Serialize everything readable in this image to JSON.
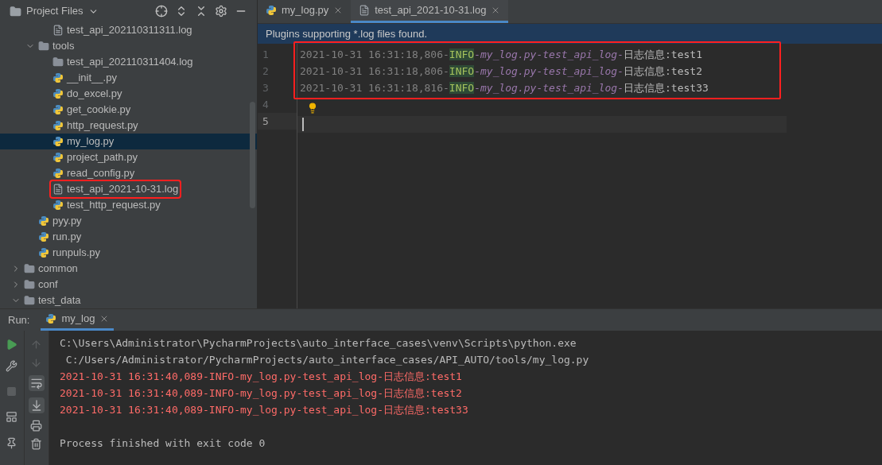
{
  "project": {
    "title": "Project Files",
    "tree": [
      {
        "children": [
          {
            "children": [
              {
                "label": "test_api_202110311311.log",
                "kind": "log",
                "selected": false,
                "outlined": false
              }
            ]
          },
          {
            "label": "tools",
            "kind": "folder",
            "expanded": true,
            "selected": false,
            "outlined": false,
            "children": [
              {
                "label": "test_api_202110311404.log",
                "kind": "plainfolder",
                "selected": false,
                "outlined": false
              },
              {
                "label": "__init__.py",
                "kind": "py",
                "selected": false,
                "outlined": false
              },
              {
                "label": "do_excel.py",
                "kind": "py",
                "selected": false,
                "outlined": false
              },
              {
                "label": "get_cookie.py",
                "kind": "py",
                "selected": false,
                "outlined": false
              },
              {
                "label": "http_request.py",
                "kind": "py",
                "selected": false,
                "outlined": false
              },
              {
                "label": "my_log.py",
                "kind": "py",
                "selected": true,
                "outlined": false
              },
              {
                "label": "project_path.py",
                "kind": "py",
                "selected": false,
                "outlined": false
              },
              {
                "label": "read_config.py",
                "kind": "py",
                "selected": false,
                "outlined": false
              },
              {
                "label": "test_api_2021-10-31.log",
                "kind": "log",
                "selected": false,
                "outlined": true
              },
              {
                "label": "test_http_request.py",
                "kind": "py",
                "selected": false,
                "outlined": false
              }
            ]
          },
          {
            "label": "pyy.py",
            "kind": "py",
            "selected": false,
            "outlined": false
          },
          {
            "label": "run.py",
            "kind": "py",
            "selected": false,
            "outlined": false
          },
          {
            "label": "runpuls.py",
            "kind": "py",
            "selected": false,
            "outlined": false
          }
        ]
      },
      {
        "label": "common",
        "kind": "folder",
        "expanded": false,
        "selected": false,
        "outlined": false
      },
      {
        "label": "conf",
        "kind": "folder",
        "expanded": false,
        "selected": false,
        "outlined": false
      },
      {
        "label": "test_data",
        "kind": "folder",
        "expanded": true,
        "selected": false,
        "outlined": false
      }
    ]
  },
  "editor": {
    "tabs": [
      {
        "label": "my_log.py",
        "kind": "py",
        "selected": false
      },
      {
        "label": "test_api_2021-10-31.log",
        "kind": "log",
        "selected": true
      }
    ],
    "banner": "Plugins supporting *.log files found.",
    "lines": [
      {
        "number": "1",
        "in_box": true,
        "current": false,
        "bulb": false,
        "segments": [
          {
            "text": "2021-10-31 16:31:18,806-",
            "kind": "time"
          },
          {
            "text": "INFO",
            "kind": "level"
          },
          {
            "text": "-my_log.py-test_api_log-",
            "kind": "name"
          },
          {
            "text": "日志信息:test1",
            "kind": "msg"
          }
        ]
      },
      {
        "number": "2",
        "in_box": true,
        "current": false,
        "bulb": false,
        "segments": [
          {
            "text": "2021-10-31 16:31:18,806-",
            "kind": "time"
          },
          {
            "text": "INFO",
            "kind": "level"
          },
          {
            "text": "-my_log.py-test_api_log-",
            "kind": "name"
          },
          {
            "text": "日志信息:test2",
            "kind": "msg"
          }
        ]
      },
      {
        "number": "3",
        "in_box": true,
        "current": false,
        "bulb": false,
        "segments": [
          {
            "text": "2021-10-31 16:31:18,816-",
            "kind": "time"
          },
          {
            "text": "INFO",
            "kind": "level"
          },
          {
            "text": "-my_log.py-test_api_log-",
            "kind": "name"
          },
          {
            "text": "日志信息:test33",
            "kind": "msg"
          }
        ]
      },
      {
        "number": "4",
        "in_box": false,
        "current": false,
        "bulb": true
      },
      {
        "number": "5",
        "in_box": false,
        "current": true,
        "bulb": false
      }
    ]
  },
  "run": {
    "label": "Run:",
    "tab": "my_log",
    "output": [
      {
        "text": "C:\\Users\\Administrator\\PycharmProjects\\auto_interface_cases\\venv\\Scripts\\python.exe",
        "kind": "plain"
      },
      {
        "text": " C:/Users/Administrator/PycharmProjects/auto_interface_cases/API_AUTO/tools/my_log.py",
        "kind": "plain"
      },
      {
        "text": "2021-10-31 16:31:40,089-INFO-my_log.py-test_api_log-日志信息:test1",
        "kind": "error"
      },
      {
        "text": "2021-10-31 16:31:40,089-INFO-my_log.py-test_api_log-日志信息:test2",
        "kind": "error"
      },
      {
        "text": "2021-10-31 16:31:40,089-INFO-my_log.py-test_api_log-日志信息:test33",
        "kind": "error"
      },
      {
        "kind": "blank"
      },
      {
        "text": "Process finished with exit code 0",
        "kind": "plain"
      }
    ]
  }
}
